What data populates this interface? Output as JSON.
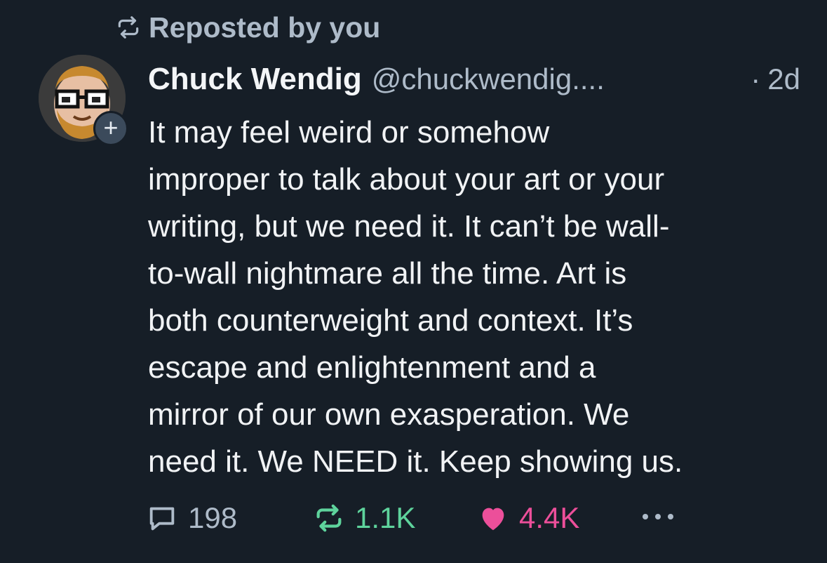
{
  "repost_banner": {
    "label": "Reposted by you"
  },
  "author": {
    "display_name": "Chuck Wendig",
    "handle": "@chuckwendig....",
    "time_separator": "·",
    "time": "2d",
    "follow_badge": "+"
  },
  "post": {
    "lines": [
      "It may feel weird or somehow",
      "improper to talk about your art or your",
      "writing, but we need it. It can’t be wall-",
      "to-wall nightmare all the time. Art is",
      "both counterweight and context. It’s",
      "escape and enlightenment and a",
      "mirror of our own exasperation. We",
      "need it. We NEED it. Keep showing us."
    ]
  },
  "actions": {
    "reply_count": "198",
    "repost_count": "1.1K",
    "like_count": "4.4K"
  },
  "colors": {
    "background": "#161e27",
    "muted": "#aebbc9",
    "repost_green": "#5ed39c",
    "like_pink": "#ec4f9a"
  },
  "icons": [
    "repost-icon",
    "reply-icon",
    "heart-icon",
    "more-icon"
  ]
}
